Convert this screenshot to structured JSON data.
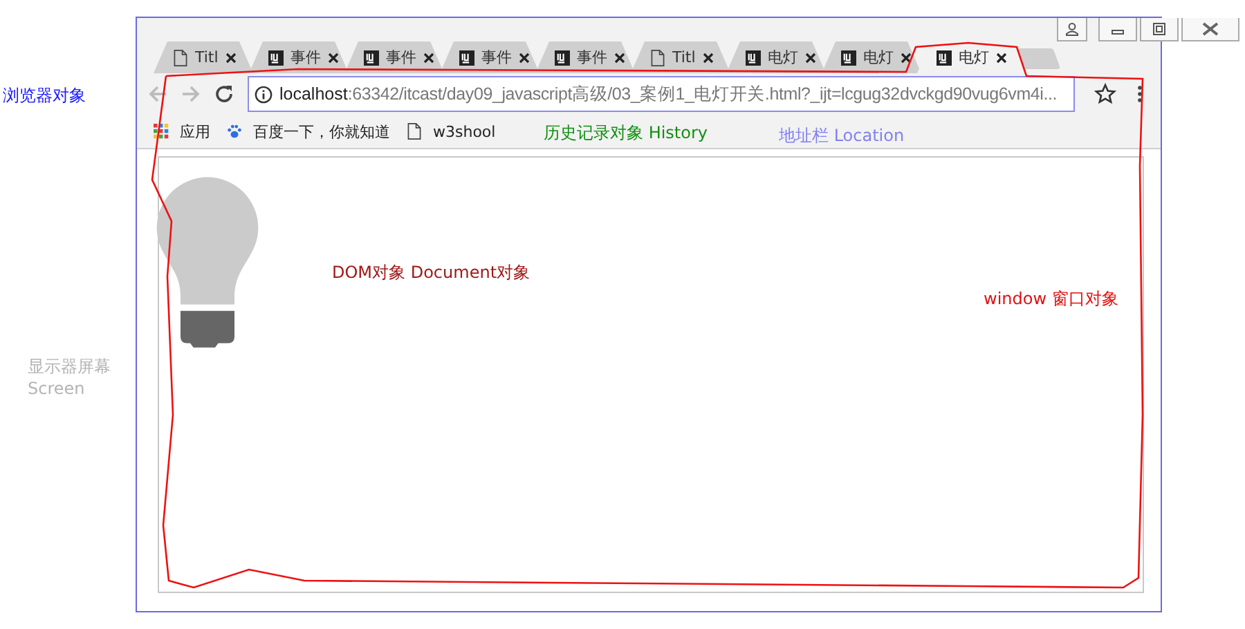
{
  "tabs": [
    {
      "kind": "page",
      "label": "Titl",
      "selected": false
    },
    {
      "kind": "ide",
      "label": "事件",
      "selected": false
    },
    {
      "kind": "ide",
      "label": "事件",
      "selected": false
    },
    {
      "kind": "ide",
      "label": "事件",
      "selected": false
    },
    {
      "kind": "ide",
      "label": "事件",
      "selected": false
    },
    {
      "kind": "page",
      "label": "Titl",
      "selected": false
    },
    {
      "kind": "ide",
      "label": "电灯",
      "selected": false
    },
    {
      "kind": "ide",
      "label": "电灯",
      "selected": false
    },
    {
      "kind": "ide",
      "label": "电灯",
      "selected": true
    }
  ],
  "address": {
    "host": "localhost",
    "rest": ":63342/itcast/day09_javascript高级/03_案例1_电灯开关.html?_ijt=lcgug32dvckgd90vug6vm4i..."
  },
  "bookmarks": [
    {
      "kind": "apps",
      "label": "应用"
    },
    {
      "kind": "paw",
      "label": "百度一下，你就知道"
    },
    {
      "kind": "page",
      "label": "w3shool"
    }
  ],
  "annotations": [
    {
      "kind": "browser",
      "text": "浏览器对象",
      "color": "#1a1aff"
    },
    {
      "kind": "screen",
      "text": "显示器屏幕",
      "subtext": "Screen",
      "color": "#b4b4b4"
    },
    {
      "kind": "history",
      "text": "历史记录对象 History",
      "color": "#109010"
    },
    {
      "kind": "location",
      "text": "地址栏 Location",
      "color": "#8080f0"
    },
    {
      "kind": "document",
      "text": "DOM对象 Document对象",
      "color": "#a01818"
    },
    {
      "kind": "window",
      "text": "window 窗口对象",
      "color": "#e01010"
    }
  ]
}
